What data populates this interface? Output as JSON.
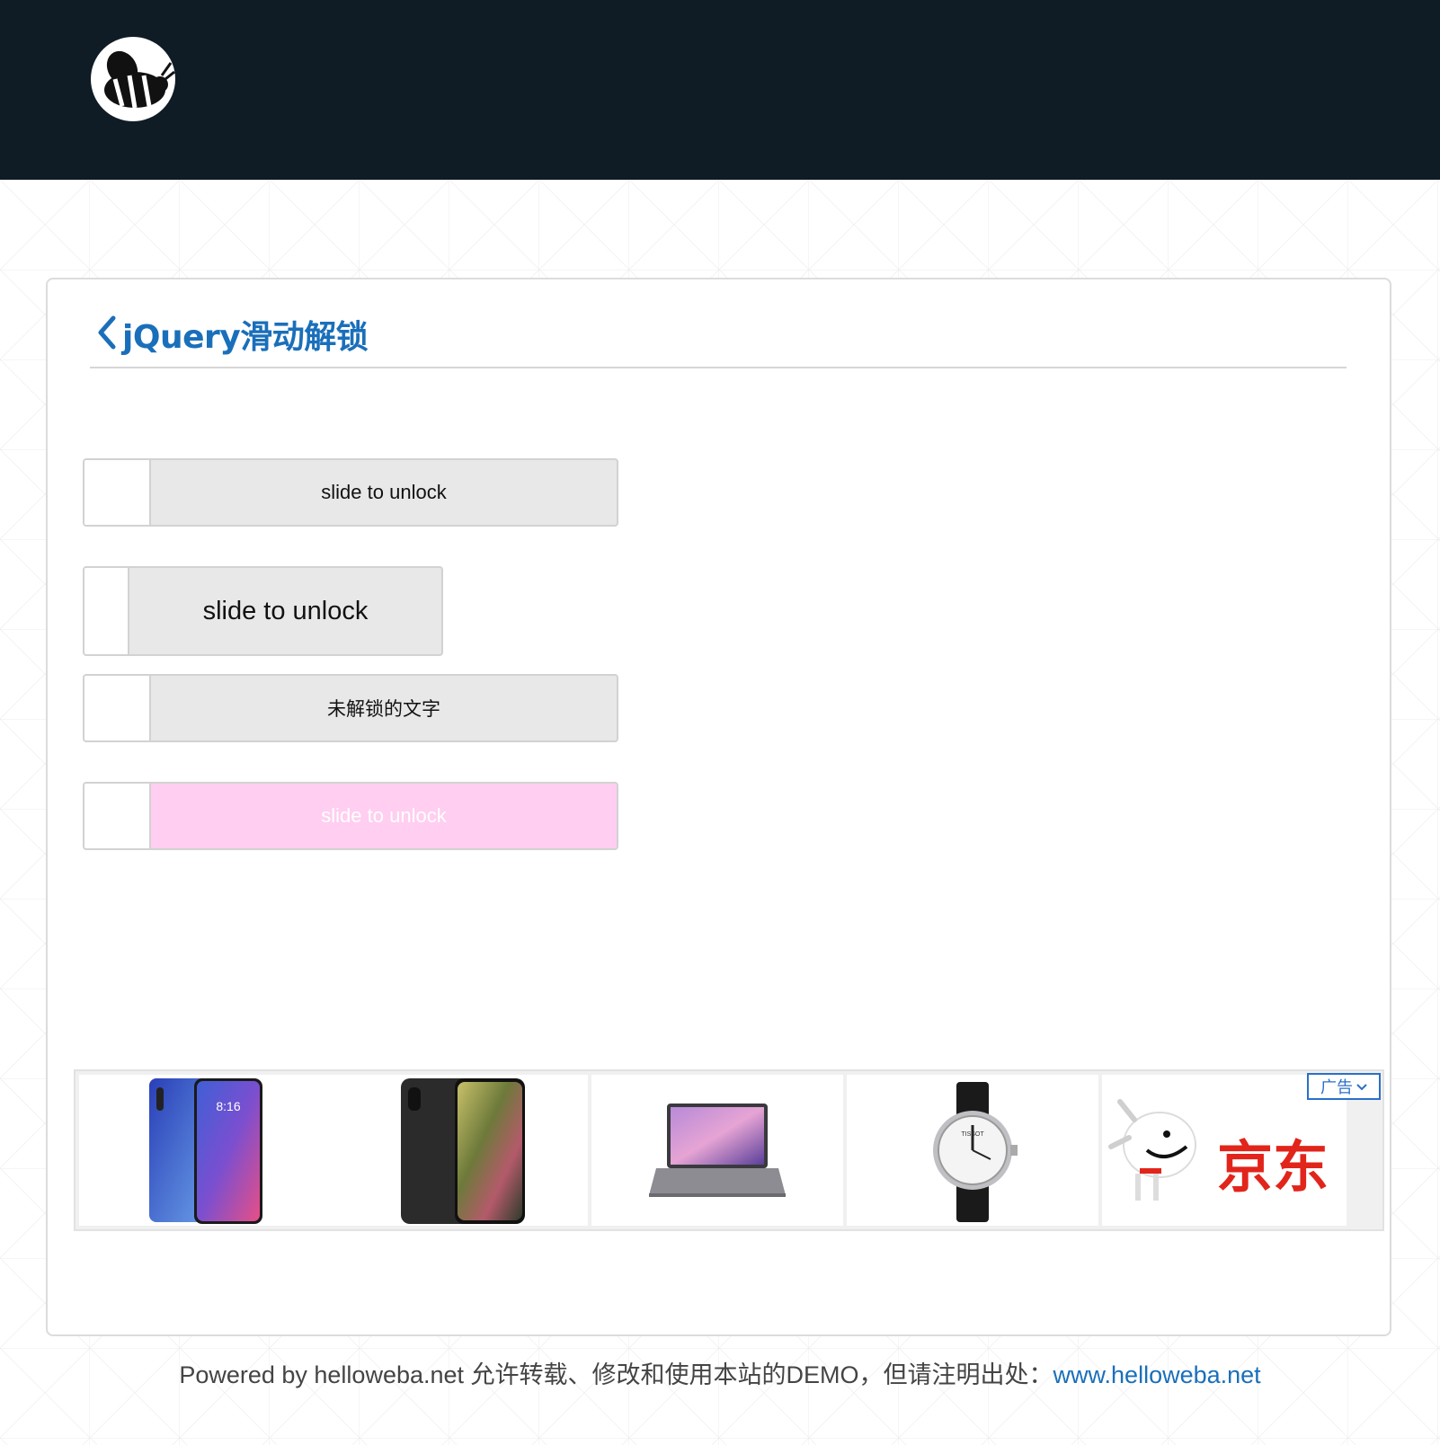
{
  "header": {
    "logo_icon": "bee-logo-icon",
    "background": "#0f1c26"
  },
  "page": {
    "back_icon": "chevron-left-icon",
    "title": "jQuery滑动解锁",
    "title_color": "#1a6fba"
  },
  "sliders": [
    {
      "label": "slide to unlock"
    },
    {
      "label": "slide to unlock"
    },
    {
      "label": "未解锁的文字"
    },
    {
      "label": "slide to unlock",
      "background": "#ffcef0"
    }
  ],
  "ads": {
    "badge": "广告",
    "items": [
      {
        "name": "xiaomi-phone",
        "clock": "8:16"
      },
      {
        "name": "iphone"
      },
      {
        "name": "laptop"
      },
      {
        "name": "wristwatch",
        "brand": "TISSOT"
      },
      {
        "name": "jd-brand",
        "brand": "京东"
      }
    ]
  },
  "footer": {
    "text": "Powered by helloweba.net 允许转载、修改和使用本站的DEMO，但请注明出处：",
    "link_text": "www.helloweba.net",
    "link_color": "#1a6fba"
  }
}
